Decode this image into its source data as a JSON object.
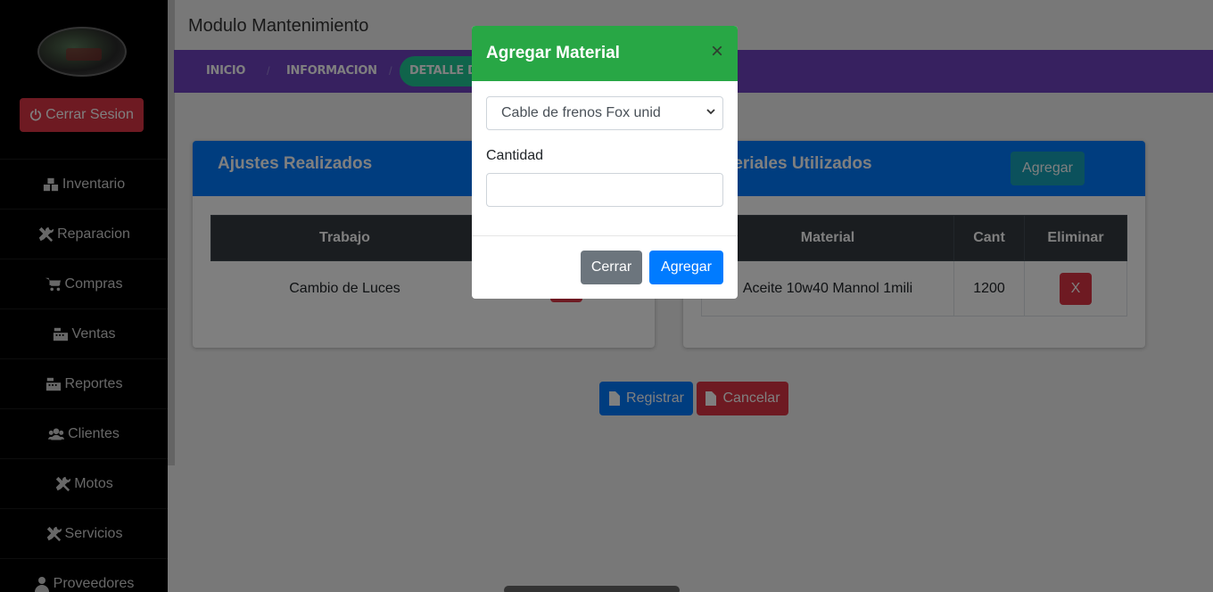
{
  "sidebar": {
    "logout_label": "Cerrar Sesion",
    "items": [
      {
        "label": "Inventario",
        "icon": "boxes-icon"
      },
      {
        "label": "Reparacion",
        "icon": "tools-icon"
      },
      {
        "label": "Compras",
        "icon": "cart-icon"
      },
      {
        "label": "Ventas",
        "icon": "cash-register-icon"
      },
      {
        "label": "Reportes",
        "icon": "cash-register-icon"
      },
      {
        "label": "Clientes",
        "icon": "users-icon"
      },
      {
        "label": "Motos",
        "icon": "tools-icon"
      },
      {
        "label": "Servicios",
        "icon": "tools-icon"
      },
      {
        "label": "Proveedores",
        "icon": "user-tie-icon"
      }
    ]
  },
  "header": {
    "title": "Modulo Mantenimiento",
    "breadcrumbs": [
      "INICIO",
      "INFORMACION",
      "DETALLE DE"
    ],
    "separator": "/"
  },
  "ajustes": {
    "title": "Ajustes Realizados",
    "columns": [
      "Trabajo"
    ],
    "rows": [
      {
        "trabajo": "Cambio de Luces"
      }
    ]
  },
  "materiales": {
    "title": "teriales Utilizados",
    "add_label": "Agregar",
    "columns": [
      "Material",
      "Cant",
      "Eliminar"
    ],
    "rows": [
      {
        "material": "Aceite 10w40 Mannol 1mili",
        "cant": "1200",
        "delete_label": "X"
      }
    ]
  },
  "actions": {
    "register_label": "Registrar",
    "cancel_label": "Cancelar"
  },
  "modal": {
    "title": "Agregar Material",
    "close_label": "×",
    "select_value": "Cable de frenos Fox unid",
    "quantity_label": "Cantidad",
    "quantity_value": "",
    "close_button": "Cerrar",
    "add_button": "Agregar"
  },
  "colors": {
    "primary": "#007bff",
    "danger": "#dc3545",
    "success": "#28a745",
    "info": "#17a2b8",
    "navbar": "#6f42c1",
    "secondary": "#6c757d"
  }
}
